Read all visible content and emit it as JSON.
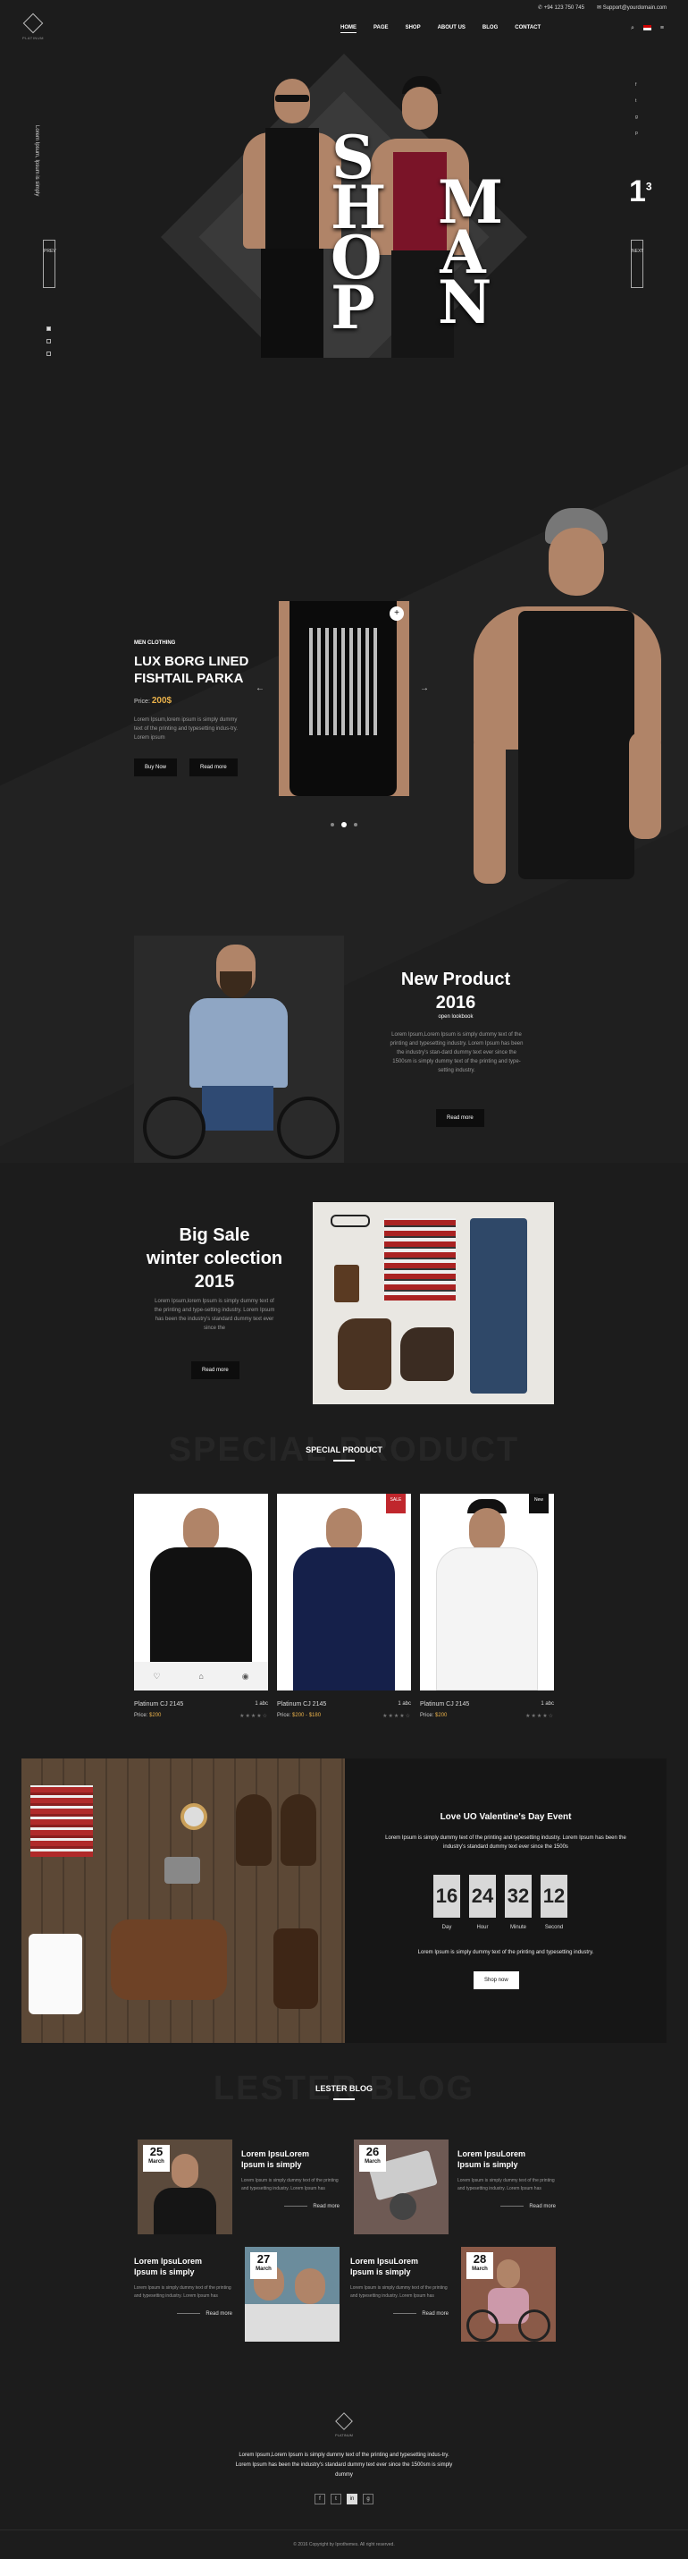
{
  "header": {
    "brand": "PLATINUM",
    "phone": "+94 123 750 745",
    "email": "Support@yourdomain.com",
    "nav": [
      "HOME",
      "PAGE",
      "SHOP",
      "ABOUT US",
      "BLOG",
      "CONTACT"
    ]
  },
  "hero": {
    "side_text": "Lorem Ipsum, Ipsum is simply",
    "prev": "PREV",
    "next": "NEXT",
    "word1": "SHOP",
    "word2": "MAN",
    "counter_current": "1",
    "counter_total": "3",
    "social": [
      "f",
      "t",
      "g",
      "p"
    ]
  },
  "featured": {
    "kicker": "MEN CLOTHING",
    "title_line1": "LUX BORG LINED",
    "title_line2": "FISHTAIL PARKA",
    "price_label": "Price:",
    "price": "200$",
    "desc": "Lorem Ipsum,lorem ipsum is simply dummy text of the printing and typesetting indus-try. Lorem ipsum",
    "buy": "Buy Now",
    "read": "Read more",
    "plus": "+",
    "arrow_left": "←",
    "arrow_right": "→"
  },
  "new_product": {
    "title_line1": "New Product",
    "title_line2": "2016",
    "sub": "open lookbook",
    "desc": "Lorem Ipsum,Lorem Ipsum is simply dummy text of the printing and typesetting industry. Lorem Ipsum has been the industry's stan-dard dummy text ever since the 1500sm is simply dummy text of the printing and type-setting industry.",
    "btn": "Read more"
  },
  "big_sale": {
    "title_line1": "Big Sale",
    "title_line2": "winter colection",
    "title_line3": "2015",
    "desc": "Lorem Ipsum,lorem Ipsum is simply dummy text of the printing and type-setting industry. Lorem Ipsum has been the industry's standard dummy text ever since the",
    "btn": "Read more"
  },
  "special": {
    "ghost": "SPECIAL PRODUCT",
    "title": "SPECIAL PRODUCT",
    "products": [
      {
        "name": "Platinum CJ 2145",
        "stock": "1 abc",
        "price_label": "Price:",
        "price": "$200",
        "old_price": "",
        "badge": "",
        "stars": "★★★★☆"
      },
      {
        "name": "Platinum CJ 2145",
        "stock": "1 abc",
        "price_label": "Price:",
        "price": "$200",
        "old_price": "- $180",
        "badge": "SALE",
        "stars": "★★★★☆"
      },
      {
        "name": "Platinum CJ 2145",
        "stock": "1 abc",
        "price_label": "Price:",
        "price": "$200",
        "old_price": "",
        "badge": "New",
        "stars": "★★★★☆"
      }
    ],
    "heart_icon": "♡",
    "bag_icon": "⌂",
    "eye_icon": "◉"
  },
  "valentine": {
    "title": "Love UO Valentine's Day Event",
    "desc": "Lorem Ipsum is simply dummy text of the printing and typesetting industry. Lorem Ipsum has been the industry's standard dummy text ever since the 1500s",
    "timer": [
      {
        "num": "16",
        "label": "Day"
      },
      {
        "num": "24",
        "label": "Hour"
      },
      {
        "num": "32",
        "label": "Minute"
      },
      {
        "num": "12",
        "label": "Second"
      }
    ],
    "desc2": "Lorem Ipsum is simply dummy text of the printing and typesetting industry.",
    "btn": "Shop now"
  },
  "blog": {
    "ghost": "LESTER BLOG",
    "title": "LESTER BLOG",
    "posts": [
      {
        "day": "25",
        "month": "March",
        "title1": "Lorem IpsuLorem",
        "title2": "Ipsum is simply",
        "excerpt": "Lorem Ipsum is simply dummy text of the printing and typesetting industry. Lorem Ipsum has",
        "more": "Read more"
      },
      {
        "day": "26",
        "month": "March",
        "title1": "Lorem IpsuLorem",
        "title2": "Ipsum is simply",
        "excerpt": "Lorem Ipsum is simply dummy text of the printing and typesetting industry. Lorem Ipsum has",
        "more": "Read more"
      },
      {
        "day": "27",
        "month": "March",
        "title1": "Lorem IpsuLorem",
        "title2": "Ipsum is simply",
        "excerpt": "Lorem Ipsum is simply dummy text of the printing and typesetting industry. Lorem Ipsum has",
        "more": "Read more"
      },
      {
        "day": "28",
        "month": "March",
        "title1": "Lorem IpsuLorem",
        "title2": "Ipsum is simply",
        "excerpt": "Lorem Ipsum is simply dummy text of the printing and typesetting industry. Lorem Ipsum has",
        "more": "Read more"
      }
    ]
  },
  "footer": {
    "brand": "PLATINUM",
    "desc": "Lorem Ipsum,Lorem Ipsum is simply dummy text of the printing and typesetting indus-try. Lorem Ipsum has been the industry's standard dummy text ever since the 1500sm is simply dummy",
    "social": [
      "f",
      "t",
      "in",
      "g"
    ],
    "copyright": "© 2016 Copyright by Iprothemes. All right reserved."
  }
}
